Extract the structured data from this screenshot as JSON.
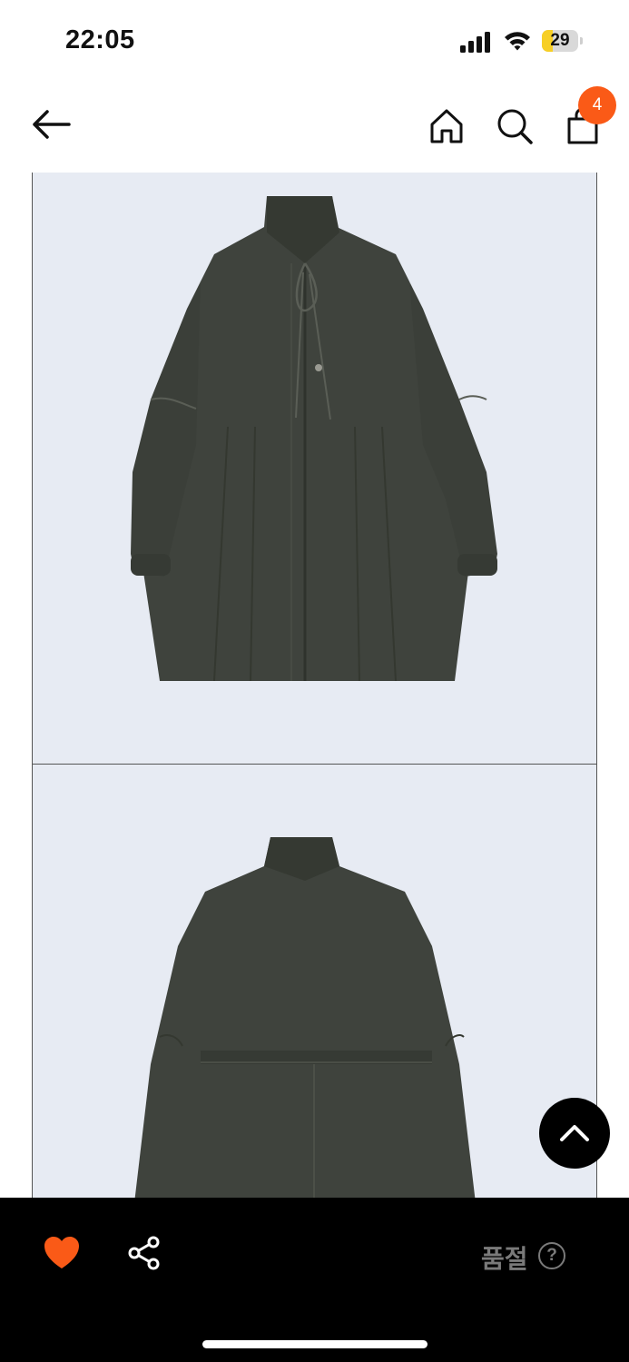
{
  "status_bar": {
    "time": "22:05",
    "battery_level": "29",
    "battery_fill_percent": 29,
    "icons": [
      "signal-icon",
      "wifi-icon",
      "battery-icon"
    ]
  },
  "nav": {
    "icons": [
      "back-arrow-icon",
      "home-icon",
      "search-icon",
      "shopping-bag-icon"
    ],
    "cart_count": "4",
    "accent_color": "#fa5a17"
  },
  "gallery": {
    "images": [
      "product-front-image",
      "product-back-image"
    ],
    "background_color": "#e7ebf3",
    "product_color": "#3f433d"
  },
  "bottom_bar": {
    "like_icon": "heart-icon",
    "share_icon": "share-icon",
    "status_label": "품절",
    "help_symbol": "?",
    "heart_color": "#fa5a17"
  },
  "scroll_top": {
    "icon": "chevron-up-icon"
  }
}
